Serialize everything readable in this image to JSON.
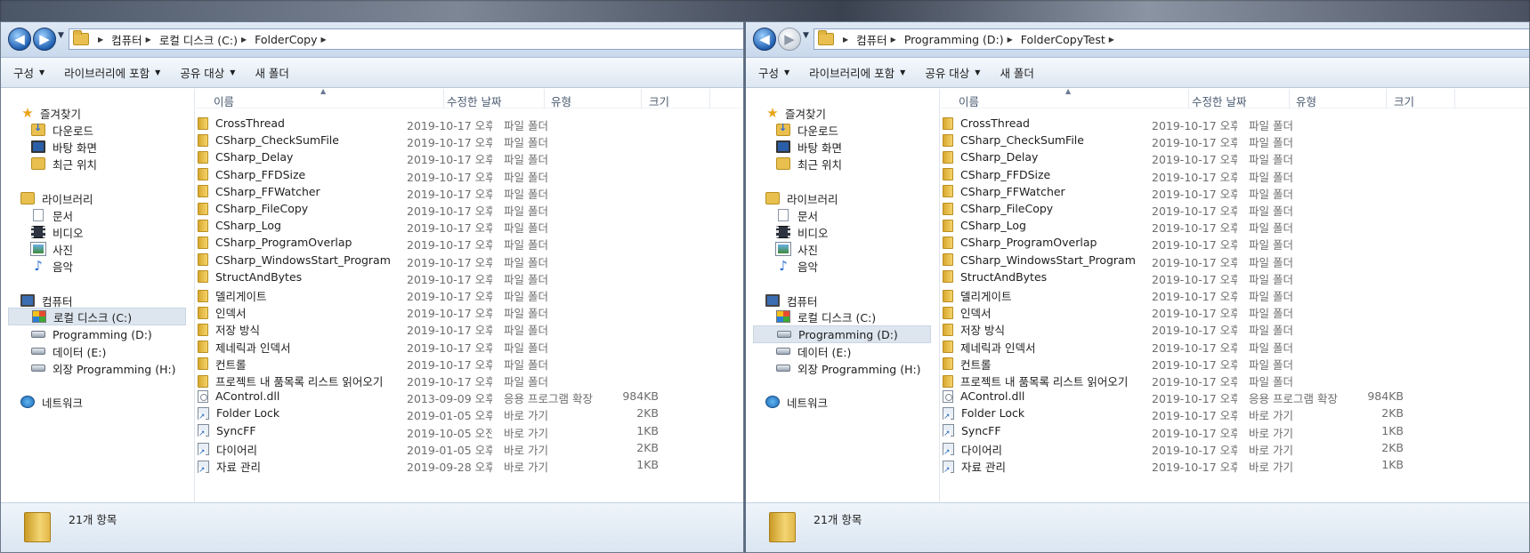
{
  "windows": [
    {
      "address": {
        "crumbs": [
          "컴퓨터",
          "로컬 디스크 (C:)",
          "FolderCopy"
        ]
      },
      "toolbar": {
        "organize": "구성",
        "include_library": "라이브러리에 포함",
        "share": "공유 대상",
        "new_folder": "새 폴더"
      },
      "sidebar": {
        "favorites": "즐겨찾기",
        "downloads": "다운로드",
        "desktop": "바탕 화면",
        "recent": "최근 위치",
        "libraries": "라이브러리",
        "documents": "문서",
        "videos": "비디오",
        "pictures": "사진",
        "music": "음악",
        "computer": "컴퓨터",
        "drive_c": "로컬 디스크 (C:)",
        "drive_d": "Programming (D:)",
        "drive_e": "데이터 (E:)",
        "drive_h": "외장 Programming (H:)",
        "network": "네트워크",
        "selected": "drive_c"
      },
      "columns": {
        "name": "이름",
        "date": "수정한 날짜",
        "type": "유형",
        "size": "크기"
      },
      "files": [
        {
          "icon": "folder",
          "name": "CrossThread",
          "date": "2019-10-17 오후...",
          "type": "파일 폴더",
          "size": ""
        },
        {
          "icon": "folder",
          "name": "CSharp_CheckSumFile",
          "date": "2019-10-17 오후...",
          "type": "파일 폴더",
          "size": ""
        },
        {
          "icon": "folder",
          "name": "CSharp_Delay",
          "date": "2019-10-17 오후...",
          "type": "파일 폴더",
          "size": ""
        },
        {
          "icon": "folder",
          "name": "CSharp_FFDSize",
          "date": "2019-10-17 오후...",
          "type": "파일 폴더",
          "size": ""
        },
        {
          "icon": "folder",
          "name": "CSharp_FFWatcher",
          "date": "2019-10-17 오후...",
          "type": "파일 폴더",
          "size": ""
        },
        {
          "icon": "folder",
          "name": "CSharp_FileCopy",
          "date": "2019-10-17 오후...",
          "type": "파일 폴더",
          "size": ""
        },
        {
          "icon": "folder",
          "name": "CSharp_Log",
          "date": "2019-10-17 오후...",
          "type": "파일 폴더",
          "size": ""
        },
        {
          "icon": "folder",
          "name": "CSharp_ProgramOverlap",
          "date": "2019-10-17 오후...",
          "type": "파일 폴더",
          "size": ""
        },
        {
          "icon": "folder",
          "name": "CSharp_WindowsStart_Program",
          "date": "2019-10-17 오후...",
          "type": "파일 폴더",
          "size": ""
        },
        {
          "icon": "folder",
          "name": "StructAndBytes",
          "date": "2019-10-17 오후...",
          "type": "파일 폴더",
          "size": ""
        },
        {
          "icon": "folder",
          "name": "델리게이트",
          "date": "2019-10-17 오후...",
          "type": "파일 폴더",
          "size": ""
        },
        {
          "icon": "folder",
          "name": "인덱서",
          "date": "2019-10-17 오후...",
          "type": "파일 폴더",
          "size": ""
        },
        {
          "icon": "folder",
          "name": "저장 방식",
          "date": "2019-10-17 오후...",
          "type": "파일 폴더",
          "size": ""
        },
        {
          "icon": "folder",
          "name": "제네릭과 인덱서",
          "date": "2019-10-17 오후...",
          "type": "파일 폴더",
          "size": ""
        },
        {
          "icon": "folder",
          "name": "컨트롤",
          "date": "2019-10-17 오후...",
          "type": "파일 폴더",
          "size": ""
        },
        {
          "icon": "folder",
          "name": "프로젝트 내 품목록 리스트 읽어오기",
          "date": "2019-10-17 오후...",
          "type": "파일 폴더",
          "size": ""
        },
        {
          "icon": "dll",
          "name": "AControl.dll",
          "date": "2013-09-09 오후...",
          "type": "응용 프로그램 확장",
          "size": "984KB"
        },
        {
          "icon": "shortcut",
          "name": "Folder Lock",
          "date": "2019-01-05 오후...",
          "type": "바로 가기",
          "size": "2KB"
        },
        {
          "icon": "shortcut",
          "name": "SyncFF",
          "date": "2019-10-05 오전...",
          "type": "바로 가기",
          "size": "1KB"
        },
        {
          "icon": "shortcut",
          "name": "다이어리",
          "date": "2019-01-05 오후...",
          "type": "바로 가기",
          "size": "2KB"
        },
        {
          "icon": "shortcut",
          "name": "자료 관리",
          "date": "2019-09-28 오후...",
          "type": "바로 가기",
          "size": "1KB"
        }
      ],
      "status": {
        "count": "21개 항목"
      }
    },
    {
      "address": {
        "crumbs": [
          "컴퓨터",
          "Programming (D:)",
          "FolderCopyTest"
        ]
      },
      "toolbar": {
        "organize": "구성",
        "include_library": "라이브러리에 포함",
        "share": "공유 대상",
        "new_folder": "새 폴더"
      },
      "sidebar": {
        "favorites": "즐겨찾기",
        "downloads": "다운로드",
        "desktop": "바탕 화면",
        "recent": "최근 위치",
        "libraries": "라이브러리",
        "documents": "문서",
        "videos": "비디오",
        "pictures": "사진",
        "music": "음악",
        "computer": "컴퓨터",
        "drive_c": "로컬 디스크 (C:)",
        "drive_d": "Programming (D:)",
        "drive_e": "데이터 (E:)",
        "drive_h": "외장 Programming (H:)",
        "network": "네트워크",
        "selected": "drive_d"
      },
      "columns": {
        "name": "이름",
        "date": "수정한 날짜",
        "type": "유형",
        "size": "크기"
      },
      "files": [
        {
          "icon": "folder",
          "name": "CrossThread",
          "date": "2019-10-17 오후...",
          "type": "파일 폴더",
          "size": ""
        },
        {
          "icon": "folder",
          "name": "CSharp_CheckSumFile",
          "date": "2019-10-17 오후...",
          "type": "파일 폴더",
          "size": ""
        },
        {
          "icon": "folder",
          "name": "CSharp_Delay",
          "date": "2019-10-17 오후...",
          "type": "파일 폴더",
          "size": ""
        },
        {
          "icon": "folder",
          "name": "CSharp_FFDSize",
          "date": "2019-10-17 오후...",
          "type": "파일 폴더",
          "size": ""
        },
        {
          "icon": "folder",
          "name": "CSharp_FFWatcher",
          "date": "2019-10-17 오후...",
          "type": "파일 폴더",
          "size": ""
        },
        {
          "icon": "folder",
          "name": "CSharp_FileCopy",
          "date": "2019-10-17 오후...",
          "type": "파일 폴더",
          "size": ""
        },
        {
          "icon": "folder",
          "name": "CSharp_Log",
          "date": "2019-10-17 오후...",
          "type": "파일 폴더",
          "size": ""
        },
        {
          "icon": "folder",
          "name": "CSharp_ProgramOverlap",
          "date": "2019-10-17 오후...",
          "type": "파일 폴더",
          "size": ""
        },
        {
          "icon": "folder",
          "name": "CSharp_WindowsStart_Program",
          "date": "2019-10-17 오후...",
          "type": "파일 폴더",
          "size": ""
        },
        {
          "icon": "folder",
          "name": "StructAndBytes",
          "date": "2019-10-17 오후...",
          "type": "파일 폴더",
          "size": ""
        },
        {
          "icon": "folder",
          "name": "델리게이트",
          "date": "2019-10-17 오후...",
          "type": "파일 폴더",
          "size": ""
        },
        {
          "icon": "folder",
          "name": "인덱서",
          "date": "2019-10-17 오후...",
          "type": "파일 폴더",
          "size": ""
        },
        {
          "icon": "folder",
          "name": "저장 방식",
          "date": "2019-10-17 오후...",
          "type": "파일 폴더",
          "size": ""
        },
        {
          "icon": "folder",
          "name": "제네릭과 인덱서",
          "date": "2019-10-17 오후...",
          "type": "파일 폴더",
          "size": ""
        },
        {
          "icon": "folder",
          "name": "컨트롤",
          "date": "2019-10-17 오후...",
          "type": "파일 폴더",
          "size": ""
        },
        {
          "icon": "folder",
          "name": "프로젝트 내 품목록 리스트 읽어오기",
          "date": "2019-10-17 오후...",
          "type": "파일 폴더",
          "size": ""
        },
        {
          "icon": "dll",
          "name": "AControl.dll",
          "date": "2019-10-17 오후...",
          "type": "응용 프로그램 확장",
          "size": "984KB"
        },
        {
          "icon": "shortcut",
          "name": "Folder Lock",
          "date": "2019-10-17 오후...",
          "type": "바로 가기",
          "size": "2KB"
        },
        {
          "icon": "shortcut",
          "name": "SyncFF",
          "date": "2019-10-17 오후...",
          "type": "바로 가기",
          "size": "1KB"
        },
        {
          "icon": "shortcut",
          "name": "다이어리",
          "date": "2019-10-17 오후...",
          "type": "바로 가기",
          "size": "2KB"
        },
        {
          "icon": "shortcut",
          "name": "자료 관리",
          "date": "2019-10-17 오후...",
          "type": "바로 가기",
          "size": "1KB"
        }
      ],
      "status": {
        "count": "21개 항목"
      }
    }
  ]
}
